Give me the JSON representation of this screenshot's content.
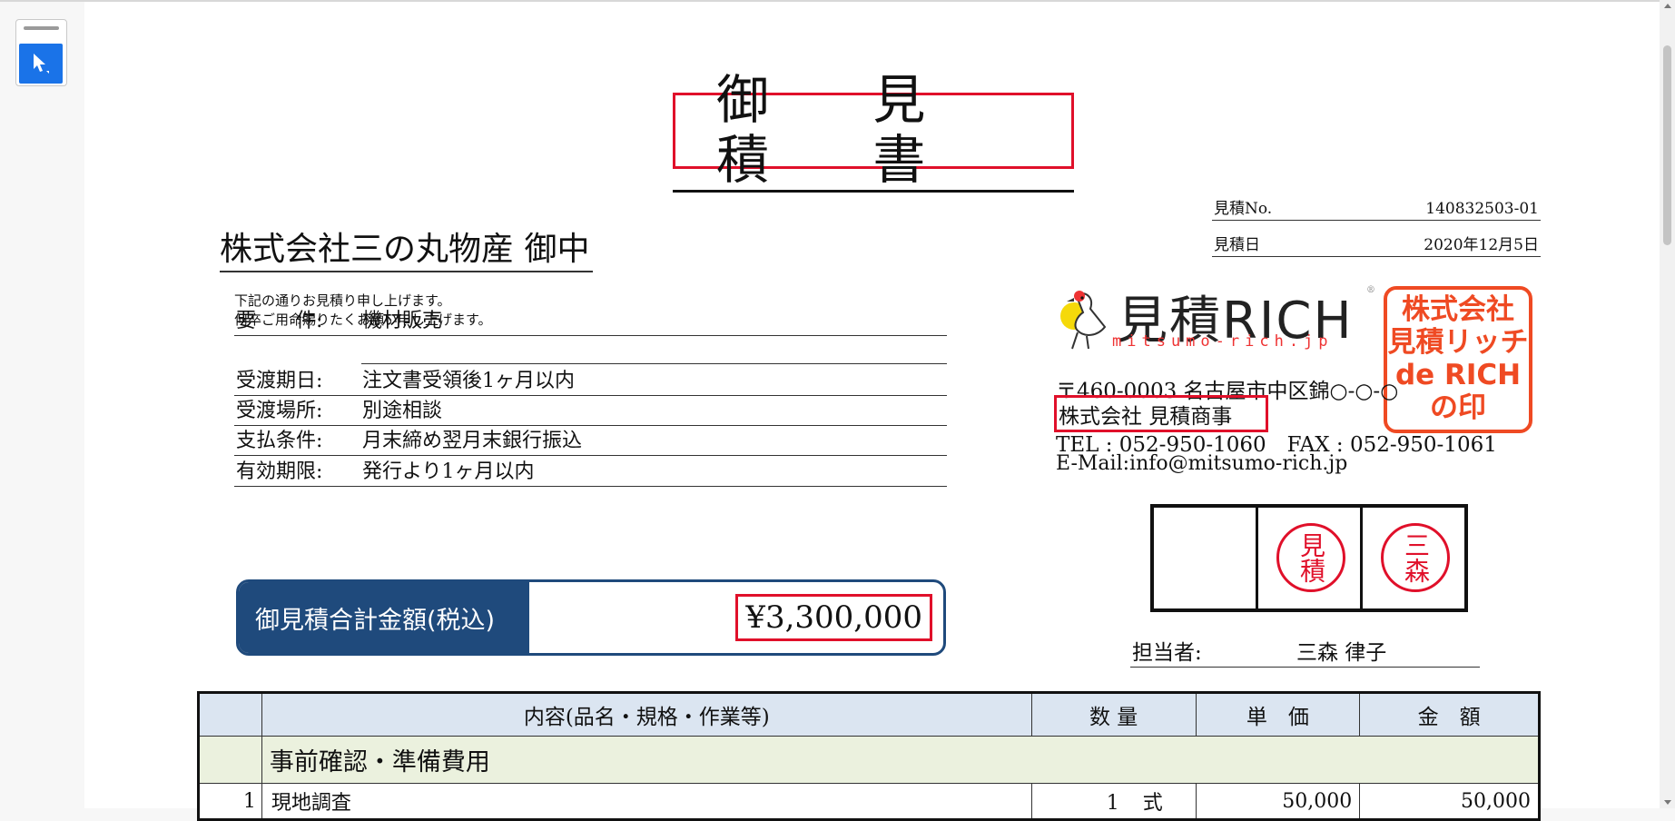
{
  "document": {
    "title": "御 見 積 書",
    "estimate_no_label": "見積No.",
    "estimate_no": "140832503-01",
    "estimate_date_label": "見積日",
    "estimate_date": "2020年12月5日",
    "client": "株式会社三の丸物産 御中",
    "intro_line1": "下記の通りお見積り申し上げます。",
    "intro_line2": "何卒ご用命賜りたくお願い申し上げます。",
    "fields": [
      {
        "label": "要　　件:",
        "value": "機材販売"
      },
      {
        "label": "受渡期日:",
        "value": "注文書受領後1ヶ月以内"
      },
      {
        "label": "受渡場所:",
        "value": "別途相談"
      },
      {
        "label": "支払条件:",
        "value": "月末締め翌月末銀行振込"
      },
      {
        "label": "有効期限:",
        "value": "発行より1ヶ月以内"
      }
    ],
    "total_label": "御見積合計金額(税込)",
    "total_amount": "¥3,300,000"
  },
  "issuer": {
    "logo_text": "見積RICH",
    "logo_sub": "mitsumo-rich.jp",
    "logo_reg": "®",
    "seal_lines": [
      "株式会社",
      "見積リッチ",
      "de RICH",
      "の印"
    ],
    "postal_address": "〒460-0003 名古屋市中区錦○-○-○",
    "company_name": "株式会社 見積商事",
    "tel_fax": "TEL : 052-950-1060　FAX : 052-950-1061",
    "email": "E-Mail:info@mitsumo-rich.jp",
    "stamps": [
      "",
      "見積",
      "三森"
    ],
    "staff_label": "担当者:",
    "staff_name": "三森 律子"
  },
  "table": {
    "headers": [
      "",
      "内容(品名・規格・作業等)",
      "数 量",
      "単　価",
      "金　額"
    ],
    "section_title": "事前確認・準備費用",
    "row": {
      "no": "1",
      "item": "現地調査",
      "qty": "1",
      "unit": "式",
      "price": "50,000",
      "amount": "50,000"
    }
  },
  "colors": {
    "accent_red": "#e0102a",
    "seal_orange": "#ef4a23",
    "total_blue": "#1f4a7c",
    "header_blue": "#dbe5f1",
    "section_green": "#ebf1de",
    "tool_blue": "#1a73e8"
  },
  "icons": {
    "tool": "pointer-select-icon",
    "logo": "bird-logo-icon"
  }
}
